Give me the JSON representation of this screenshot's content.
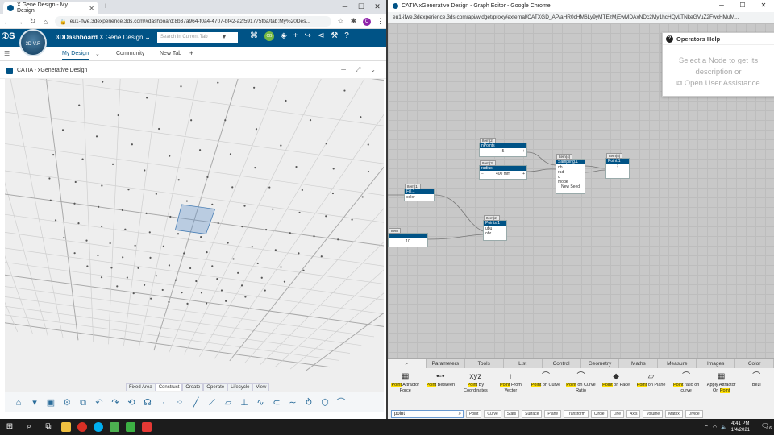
{
  "left_browser": {
    "tab_title": "X Gene Design - My Design",
    "new_tab_symbol": "+",
    "url": "eu1-ifwe.3dexperience.3ds.com/#dashboard:8b37a964-f0a4-4707-bf42-a2f591775fba/tab:My%20Des...",
    "user_initial": "C"
  },
  "dashboard": {
    "app_prefix": "3DDashboard",
    "app_name": "X Gene Design",
    "compass_label": "3D V.R",
    "search_placeholder": "Search In Current Tab",
    "user_badge": "CB",
    "tabs": [
      "My Design",
      "Community",
      "New Tab"
    ],
    "add_tab": "+"
  },
  "widget": {
    "title": "CATIA - xGenerative Design"
  },
  "command_tabs": [
    "Fixed Area",
    "Construct",
    "Create",
    "Operate",
    "Lifecycle",
    "View"
  ],
  "command_active": "Construct",
  "right_window": {
    "title": "CATIA xGenerative Design - Graph Editor - Google Chrome",
    "url": "eu1-ifwe.3dexperience.3ds.com/api/widget/proxy/external/CATXGD_AP/aHR0cHM6Ly9yMTEzMjEwMDAxNDc2My1hcHQyLTNkeGVuZ2FwcHMuM..."
  },
  "help_panel": {
    "title": "Operators Help",
    "message": "Select a Node to get its description or",
    "link": "Open User Assistance"
  },
  "nodes": {
    "n1": {
      "tag": "Item(2)",
      "title": "nPoints",
      "value": "5"
    },
    "n2": {
      "tag": "Item(3)",
      "title": "radius",
      "value": "400 mm"
    },
    "n3": {
      "tag": "Item(1)",
      "title": "Fill.1",
      "port": "color"
    },
    "n4": {
      "tag": "Item(4)",
      "title": "Sampling.1",
      "ports": [
        "nb",
        "rad",
        "c",
        "mode"
      ],
      "footer": "New Seed"
    },
    "n5": {
      "tag": "Item(5)",
      "title": "Point.1"
    },
    "n6": {
      "tag": "Item(2)",
      "title": "Points.1",
      "ports": [
        "ubu",
        "obr"
      ]
    },
    "n7": {
      "tag": "Item",
      "value": "10"
    }
  },
  "palette": {
    "tabs": [
      "search",
      "Parameters",
      "Tools",
      "List",
      "Control",
      "Geometry",
      "Maths",
      "Measure",
      "Images",
      "Color"
    ],
    "highlight_word": "Point",
    "items": [
      {
        "hl": "Point",
        "rest": " Attractor Force",
        "icon": "▦"
      },
      {
        "hl": "Point",
        "rest": " Between",
        "icon": "•-•"
      },
      {
        "hl": "Point",
        "rest": " By Coordinates",
        "icon": "xyz"
      },
      {
        "hl": "Point",
        "rest": " From Vector",
        "icon": "↑"
      },
      {
        "hl": "Point",
        "rest": " on Curve",
        "icon": "⌒"
      },
      {
        "hl": "Point",
        "rest": " on Curve Ratio",
        "icon": "⌒"
      },
      {
        "hl": "Point",
        "rest": " on Face",
        "icon": "◆"
      },
      {
        "hl": "Point",
        "rest": " on Plane",
        "icon": "▱"
      },
      {
        "hl": "Point",
        "rest": " ratio on curve",
        "icon": "⌒"
      },
      {
        "hl": "Point",
        "rest": "Apply Attractor On ",
        "icon": "▦",
        "prefix": true
      },
      {
        "hl": "",
        "rest": "Bezi",
        "icon": "⌒"
      }
    ],
    "search_value": "point",
    "filters": [
      "Point",
      "Curve",
      "Stats",
      "Surface",
      "Plane",
      "Transform",
      "Circle",
      "Line",
      "Axis",
      "Volume",
      "Matrix",
      "Divide"
    ]
  },
  "taskbar": {
    "time": "4:41 PM",
    "date": "1/4/2021",
    "notif_count": "6"
  },
  "colors": {
    "brand_blue": "#005386",
    "port_green": "#3cb043",
    "highlight": "#ffe000"
  }
}
